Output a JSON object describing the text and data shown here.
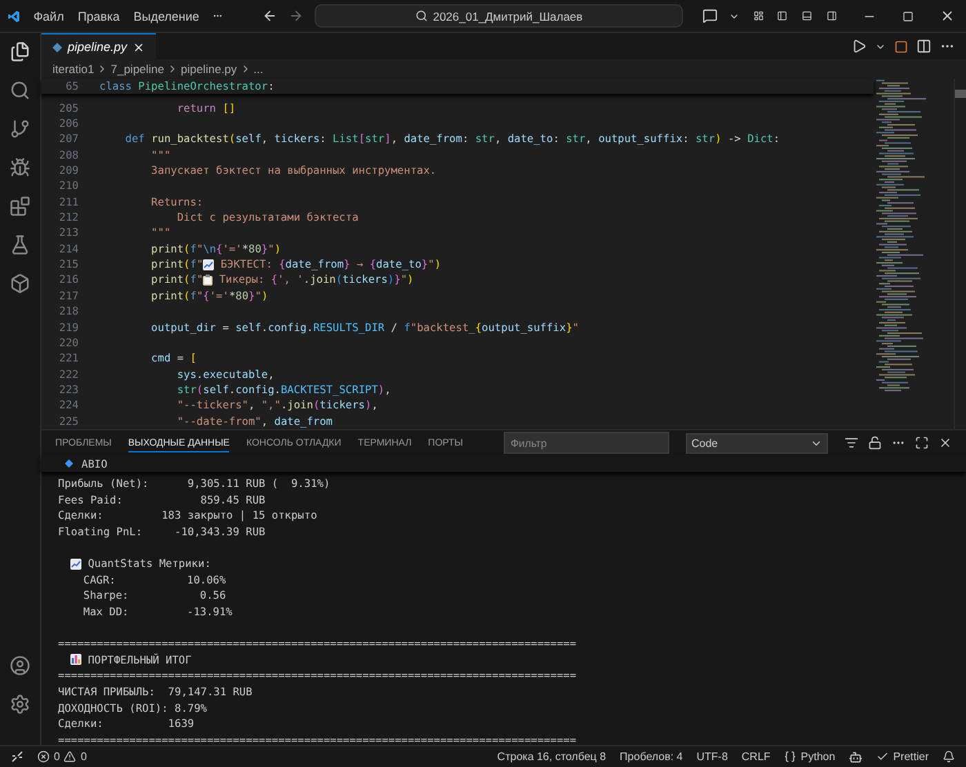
{
  "title_bar": {
    "menus": [
      "Файл",
      "Правка",
      "Выделение"
    ],
    "search": "2026_01_Дмитрий_Шалаев"
  },
  "editor_tabs": [
    {
      "label": "pipeline.py",
      "selected": true
    }
  ],
  "breadcrumbs": [
    "iteratio1",
    "7_pipeline",
    "pipeline.py",
    "..."
  ],
  "sticky_line": {
    "number": "65",
    "tokens": [
      {
        "kind": "kw",
        "text": "class "
      },
      {
        "kind": "type",
        "text": "PipelineOrchestrator"
      },
      {
        "kind": "plain",
        "text": ":"
      }
    ]
  },
  "code_lines": [
    {
      "number": "205",
      "tokens": [
        {
          "kind": "ctrl",
          "text": "            return "
        },
        {
          "kind": "brace",
          "text": "[]"
        }
      ]
    },
    {
      "number": "206"
    },
    {
      "number": "207",
      "tokens": [
        {
          "kind": "kw",
          "text": "    def "
        },
        {
          "kind": "fn",
          "text": "run_backtest"
        },
        {
          "kind": "brace",
          "text": "("
        },
        {
          "kind": "param",
          "text": "self"
        },
        {
          "kind": "plain",
          "text": ", "
        },
        {
          "kind": "param",
          "text": "tickers"
        },
        {
          "kind": "plain",
          "text": ": "
        },
        {
          "kind": "type",
          "text": "List"
        },
        {
          "kind": "brace2",
          "text": "["
        },
        {
          "kind": "type",
          "text": "str"
        },
        {
          "kind": "brace2",
          "text": "]"
        },
        {
          "kind": "plain",
          "text": ", "
        },
        {
          "kind": "param",
          "text": "date_from"
        },
        {
          "kind": "plain",
          "text": ": "
        },
        {
          "kind": "type",
          "text": "str"
        },
        {
          "kind": "plain",
          "text": ", "
        },
        {
          "kind": "param",
          "text": "date_to"
        },
        {
          "kind": "plain",
          "text": ": "
        },
        {
          "kind": "type",
          "text": "str"
        },
        {
          "kind": "plain",
          "text": ", "
        },
        {
          "kind": "param",
          "text": "output_suffix"
        },
        {
          "kind": "plain",
          "text": ": "
        },
        {
          "kind": "type",
          "text": "str"
        },
        {
          "kind": "brace",
          "text": ")"
        },
        {
          "kind": "plain",
          "text": " -> "
        },
        {
          "kind": "type",
          "text": "Dict"
        },
        {
          "kind": "plain",
          "text": ":"
        }
      ]
    },
    {
      "number": "208",
      "tokens": [
        {
          "kind": "str",
          "text": "        \"\"\""
        }
      ]
    },
    {
      "number": "209",
      "tokens": [
        {
          "kind": "str",
          "text": "        Запускает бэктест на выбранных инструментах."
        }
      ]
    },
    {
      "number": "210"
    },
    {
      "number": "211",
      "tokens": [
        {
          "kind": "str",
          "text": "        Returns:"
        }
      ]
    },
    {
      "number": "212",
      "tokens": [
        {
          "kind": "str",
          "text": "            Dict с результатами бэктеста"
        }
      ]
    },
    {
      "number": "213",
      "tokens": [
        {
          "kind": "str",
          "text": "        \"\"\""
        }
      ]
    },
    {
      "number": "214",
      "tokens": [
        {
          "kind": "fn",
          "text": "        print"
        },
        {
          "kind": "brace",
          "text": "("
        },
        {
          "kind": "kw",
          "text": "f"
        },
        {
          "kind": "str",
          "text": "\""
        },
        {
          "kind": "kw",
          "text": "\\n"
        },
        {
          "kind": "brace2",
          "text": "{"
        },
        {
          "kind": "str",
          "text": "'='"
        },
        {
          "kind": "plain",
          "text": "*"
        },
        {
          "kind": "num",
          "text": "80"
        },
        {
          "kind": "brace2",
          "text": "}"
        },
        {
          "kind": "str",
          "text": "\""
        },
        {
          "kind": "brace",
          "text": ")"
        }
      ]
    },
    {
      "number": "215",
      "tokens": [
        {
          "kind": "fn",
          "text": "        print"
        },
        {
          "kind": "brace",
          "text": "("
        },
        {
          "kind": "kw",
          "text": "f"
        },
        {
          "kind": "str",
          "text": "\""
        },
        {
          "kind": "chart-icon"
        },
        {
          "kind": "str",
          "text": " БЭКТЕСТ: "
        },
        {
          "kind": "brace2",
          "text": "{"
        },
        {
          "kind": "param",
          "text": "date_from"
        },
        {
          "kind": "brace2",
          "text": "}"
        },
        {
          "kind": "str",
          "text": " → "
        },
        {
          "kind": "brace2",
          "text": "{"
        },
        {
          "kind": "param",
          "text": "date_to"
        },
        {
          "kind": "brace2",
          "text": "}"
        },
        {
          "kind": "str",
          "text": "\""
        },
        {
          "kind": "brace",
          "text": ")"
        }
      ]
    },
    {
      "number": "216",
      "tokens": [
        {
          "kind": "fn",
          "text": "        print"
        },
        {
          "kind": "brace",
          "text": "("
        },
        {
          "kind": "kw",
          "text": "f"
        },
        {
          "kind": "str",
          "text": "\""
        },
        {
          "kind": "clipboard-icon"
        },
        {
          "kind": "str",
          "text": " Тикеры: "
        },
        {
          "kind": "brace2",
          "text": "{"
        },
        {
          "kind": "str",
          "text": "', '"
        },
        {
          "kind": "plain",
          "text": "."
        },
        {
          "kind": "fn",
          "text": "join"
        },
        {
          "kind": "brace3",
          "text": "("
        },
        {
          "kind": "param",
          "text": "tickers"
        },
        {
          "kind": "brace3",
          "text": ")"
        },
        {
          "kind": "brace2",
          "text": "}"
        },
        {
          "kind": "str",
          "text": "\""
        },
        {
          "kind": "brace",
          "text": ")"
        }
      ]
    },
    {
      "number": "217",
      "tokens": [
        {
          "kind": "fn",
          "text": "        print"
        },
        {
          "kind": "brace",
          "text": "("
        },
        {
          "kind": "kw",
          "text": "f"
        },
        {
          "kind": "str",
          "text": "\""
        },
        {
          "kind": "brace2",
          "text": "{"
        },
        {
          "kind": "str",
          "text": "'='"
        },
        {
          "kind": "plain",
          "text": "*"
        },
        {
          "kind": "num",
          "text": "80"
        },
        {
          "kind": "brace2",
          "text": "}"
        },
        {
          "kind": "str",
          "text": "\""
        },
        {
          "kind": "brace",
          "text": ")"
        }
      ]
    },
    {
      "number": "218"
    },
    {
      "number": "219",
      "tokens": [
        {
          "kind": "param",
          "text": "        output_dir"
        },
        {
          "kind": "plain",
          "text": " = "
        },
        {
          "kind": "param",
          "text": "self"
        },
        {
          "kind": "plain",
          "text": "."
        },
        {
          "kind": "param",
          "text": "config"
        },
        {
          "kind": "plain",
          "text": "."
        },
        {
          "kind": "const",
          "text": "RESULTS_DIR"
        },
        {
          "kind": "plain",
          "text": " / "
        },
        {
          "kind": "kw",
          "text": "f"
        },
        {
          "kind": "str",
          "text": "\"backtest_"
        },
        {
          "kind": "brace",
          "text": "{"
        },
        {
          "kind": "param",
          "text": "output_suffix"
        },
        {
          "kind": "brace",
          "text": "}"
        },
        {
          "kind": "str",
          "text": "\""
        }
      ]
    },
    {
      "number": "220"
    },
    {
      "number": "221",
      "tokens": [
        {
          "kind": "param",
          "text": "        cmd"
        },
        {
          "kind": "plain",
          "text": " = "
        },
        {
          "kind": "brace",
          "text": "["
        }
      ]
    },
    {
      "number": "222",
      "tokens": [
        {
          "kind": "param",
          "text": "            sys"
        },
        {
          "kind": "plain",
          "text": "."
        },
        {
          "kind": "param",
          "text": "executable"
        },
        {
          "kind": "plain",
          "text": ","
        }
      ]
    },
    {
      "number": "223",
      "tokens": [
        {
          "kind": "type",
          "text": "            str"
        },
        {
          "kind": "brace2",
          "text": "("
        },
        {
          "kind": "param",
          "text": "self"
        },
        {
          "kind": "plain",
          "text": "."
        },
        {
          "kind": "param",
          "text": "config"
        },
        {
          "kind": "plain",
          "text": "."
        },
        {
          "kind": "const",
          "text": "BACKTEST_SCRIPT"
        },
        {
          "kind": "brace2",
          "text": ")"
        },
        {
          "kind": "plain",
          "text": ","
        }
      ]
    },
    {
      "number": "224",
      "tokens": [
        {
          "kind": "str",
          "text": "            \"--tickers\""
        },
        {
          "kind": "plain",
          "text": ", "
        },
        {
          "kind": "str",
          "text": "\",\""
        },
        {
          "kind": "plain",
          "text": "."
        },
        {
          "kind": "fn",
          "text": "join"
        },
        {
          "kind": "brace2",
          "text": "("
        },
        {
          "kind": "param",
          "text": "tickers"
        },
        {
          "kind": "brace2",
          "text": ")"
        },
        {
          "kind": "plain",
          "text": ","
        }
      ]
    },
    {
      "number": "225",
      "tokens": [
        {
          "kind": "str",
          "text": "            \"--date-from\""
        },
        {
          "kind": "plain",
          "text": ", "
        },
        {
          "kind": "param",
          "text": "date_from"
        }
      ]
    }
  ],
  "panel": {
    "tabs": [
      {
        "label": "ПРОБЛЕМЫ",
        "selected": false
      },
      {
        "label": "ВЫХОДНЫЕ ДАННЫЕ",
        "selected": true
      },
      {
        "label": "КОНСОЛЬ ОТЛАДКИ",
        "selected": false
      },
      {
        "label": "ТЕРМИНАЛ",
        "selected": false
      },
      {
        "label": "ПОРТЫ",
        "selected": false
      }
    ],
    "filter": {
      "placeholder": "Фильтр"
    },
    "channel": "Code",
    "section": "ABIO",
    "lines": [
      {
        "kind": "text",
        "text": "Прибыль (Net):      9,305.11 RUB (  9.31%)"
      },
      {
        "kind": "text",
        "text": "Fees Paid:            859.45 RUB"
      },
      {
        "kind": "text",
        "text": "Сделки:         183 закрыто | 15 открыто"
      },
      {
        "kind": "text",
        "text": "Floating PnL:     -10,343.39 RUB"
      },
      {
        "kind": "blank"
      },
      {
        "kind": "chart",
        "text": " QuantStats Метрики:"
      },
      {
        "kind": "metric",
        "text": "CAGR:           10.06%"
      },
      {
        "kind": "metric",
        "text": "Sharpe:           0.56"
      },
      {
        "kind": "metric",
        "text": "Max DD:         -13.91%"
      },
      {
        "kind": "blank"
      },
      {
        "kind": "text",
        "text": "================================================================================"
      },
      {
        "kind": "bars",
        "text": " ПОРТФЕЛЬНЫЙ ИТОГ"
      },
      {
        "kind": "text",
        "text": "================================================================================"
      },
      {
        "kind": "text",
        "text": "ЧИСТАЯ ПРИБЫЛЬ:  79,147.31 RUB"
      },
      {
        "kind": "text",
        "text": "ДОХОДНОСТЬ (ROI): 8.79%"
      },
      {
        "kind": "text",
        "text": "Сделки:          1639"
      },
      {
        "kind": "text",
        "text": "================================================================================"
      }
    ]
  },
  "status_bar": {
    "errors": "0",
    "warnings": "0",
    "items": [
      {
        "kind": "text",
        "text": "Строка 16, столбец 8"
      },
      {
        "kind": "text",
        "text": "Пробелов: 4"
      },
      {
        "kind": "text",
        "text": "UTF-8"
      },
      {
        "kind": "text",
        "text": "CRLF"
      },
      {
        "kind": "braces",
        "text": "Python"
      },
      {
        "kind": "copilot"
      },
      {
        "kind": "check",
        "text": "Prettier"
      },
      {
        "kind": "bell"
      }
    ]
  }
}
